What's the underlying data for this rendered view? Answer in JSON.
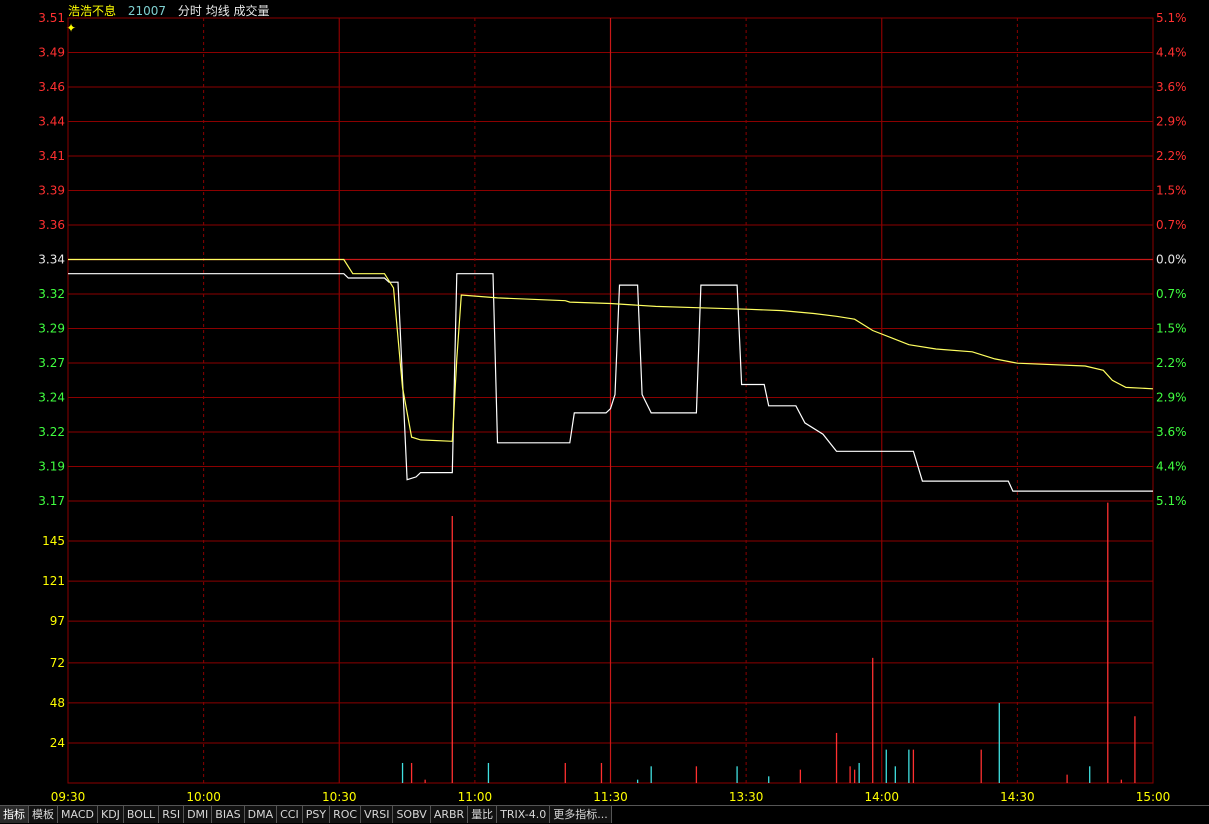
{
  "header": {
    "stock_name": "浩浩不息",
    "code": "21007",
    "tags": [
      "分时",
      "均线",
      "成交量"
    ]
  },
  "tabs": [
    "指标",
    "模板",
    "MACD",
    "KDJ",
    "BOLL",
    "RSI",
    "DMI",
    "BIAS",
    "DMA",
    "CCI",
    "PSY",
    "ROC",
    "VRSI",
    "SOBV",
    "ARBR",
    "量比",
    "TRIX-4.0",
    "更多指标..."
  ],
  "colors": {
    "background": "#000000",
    "grid": "#8b0000",
    "up": "#ff3030",
    "down": "#40ff40",
    "flat": "#e8e8e8",
    "volume_tick": "#ffff00",
    "price_line": "#ffffff",
    "avg_line": "#ffff60",
    "vol_up": "#ff3030",
    "vol_down": "#40e0e0"
  },
  "chart_data": {
    "type": "line",
    "prev_close": 3.34,
    "price_axis": {
      "ticks": [
        "3.51",
        "3.49",
        "3.46",
        "3.44",
        "3.41",
        "3.39",
        "3.36",
        "3.34",
        "3.32",
        "3.29",
        "3.27",
        "3.24",
        "3.22",
        "3.19",
        "3.17"
      ],
      "pct_ticks": [
        "5.1%",
        "4.4%",
        "3.6%",
        "2.9%",
        "2.2%",
        "1.5%",
        "0.7%",
        "0.0%",
        "0.7%",
        "1.5%",
        "2.2%",
        "2.9%",
        "3.6%",
        "4.4%",
        "5.1%"
      ],
      "ylim": [
        3.17,
        3.51
      ]
    },
    "volume_axis": {
      "ticks": [
        "145",
        "121",
        "97",
        "72",
        "48",
        "24"
      ],
      "ylim": [
        0,
        169
      ]
    },
    "time_labels": [
      "09:30",
      "10:00",
      "10:30",
      "11:00",
      "11:30",
      "13:30",
      "14:00",
      "14:30",
      "15:00"
    ],
    "series": [
      {
        "name": "分时",
        "points": [
          [
            0,
            3.33
          ],
          [
            61,
            3.33
          ],
          [
            62,
            3.327
          ],
          [
            70,
            3.327
          ],
          [
            71,
            3.324
          ],
          [
            73,
            3.324
          ],
          [
            75,
            3.185
          ],
          [
            77,
            3.187
          ],
          [
            78,
            3.19
          ],
          [
            85,
            3.19
          ],
          [
            86,
            3.33
          ],
          [
            94,
            3.33
          ],
          [
            95,
            3.211
          ],
          [
            111,
            3.211
          ],
          [
            112,
            3.232
          ],
          [
            119,
            3.232
          ],
          [
            120,
            3.235
          ],
          [
            121,
            3.245
          ],
          [
            122,
            3.322
          ],
          [
            126,
            3.322
          ],
          [
            127,
            3.245
          ],
          [
            129,
            3.232
          ],
          [
            139,
            3.232
          ],
          [
            140,
            3.322
          ],
          [
            148,
            3.322
          ],
          [
            149,
            3.252
          ],
          [
            154,
            3.252
          ],
          [
            155,
            3.237
          ],
          [
            161,
            3.237
          ],
          [
            163,
            3.225
          ],
          [
            167,
            3.217
          ],
          [
            170,
            3.205
          ],
          [
            187,
            3.205
          ],
          [
            189,
            3.184
          ],
          [
            208,
            3.184
          ],
          [
            209,
            3.177
          ],
          [
            240,
            3.177
          ]
        ]
      },
      {
        "name": "均线",
        "points": [
          [
            0,
            3.34
          ],
          [
            61,
            3.34
          ],
          [
            63,
            3.33
          ],
          [
            70,
            3.33
          ],
          [
            72,
            3.32
          ],
          [
            74,
            3.25
          ],
          [
            76,
            3.215
          ],
          [
            78,
            3.213
          ],
          [
            85,
            3.212
          ],
          [
            86,
            3.27
          ],
          [
            87,
            3.315
          ],
          [
            95,
            3.313
          ],
          [
            110,
            3.311
          ],
          [
            111,
            3.31
          ],
          [
            120,
            3.309
          ],
          [
            130,
            3.307
          ],
          [
            140,
            3.306
          ],
          [
            150,
            3.305
          ],
          [
            158,
            3.304
          ],
          [
            165,
            3.302
          ],
          [
            170,
            3.3
          ],
          [
            174,
            3.298
          ],
          [
            178,
            3.29
          ],
          [
            182,
            3.285
          ],
          [
            186,
            3.28
          ],
          [
            192,
            3.277
          ],
          [
            200,
            3.275
          ],
          [
            205,
            3.27
          ],
          [
            210,
            3.267
          ],
          [
            225,
            3.265
          ],
          [
            229,
            3.262
          ],
          [
            231,
            3.255
          ],
          [
            234,
            3.25
          ],
          [
            240,
            3.249
          ]
        ]
      }
    ],
    "volume": [
      {
        "t": 74,
        "v": 12,
        "dir": "down"
      },
      {
        "t": 76,
        "v": 12,
        "dir": "up"
      },
      {
        "t": 79,
        "v": 2,
        "dir": "up"
      },
      {
        "t": 85,
        "v": 160,
        "dir": "up"
      },
      {
        "t": 93,
        "v": 12,
        "dir": "down"
      },
      {
        "t": 110,
        "v": 12,
        "dir": "up"
      },
      {
        "t": 118,
        "v": 12,
        "dir": "up"
      },
      {
        "t": 126,
        "v": 2,
        "dir": "down"
      },
      {
        "t": 129,
        "v": 10,
        "dir": "down"
      },
      {
        "t": 139,
        "v": 10,
        "dir": "up"
      },
      {
        "t": 148,
        "v": 10,
        "dir": "down"
      },
      {
        "t": 155,
        "v": 4,
        "dir": "down"
      },
      {
        "t": 162,
        "v": 8,
        "dir": "up"
      },
      {
        "t": 170,
        "v": 30,
        "dir": "up"
      },
      {
        "t": 173,
        "v": 10,
        "dir": "up"
      },
      {
        "t": 174,
        "v": 8,
        "dir": "up"
      },
      {
        "t": 175,
        "v": 12,
        "dir": "down"
      },
      {
        "t": 178,
        "v": 75,
        "dir": "up"
      },
      {
        "t": 181,
        "v": 20,
        "dir": "down"
      },
      {
        "t": 183,
        "v": 10,
        "dir": "down"
      },
      {
        "t": 186,
        "v": 20,
        "dir": "down"
      },
      {
        "t": 187,
        "v": 20,
        "dir": "up"
      },
      {
        "t": 202,
        "v": 20,
        "dir": "up"
      },
      {
        "t": 206,
        "v": 48,
        "dir": "down"
      },
      {
        "t": 221,
        "v": 5,
        "dir": "up"
      },
      {
        "t": 226,
        "v": 10,
        "dir": "down"
      },
      {
        "t": 230,
        "v": 168,
        "dir": "up"
      },
      {
        "t": 233,
        "v": 2,
        "dir": "up"
      },
      {
        "t": 236,
        "v": 40,
        "dir": "up"
      }
    ]
  }
}
